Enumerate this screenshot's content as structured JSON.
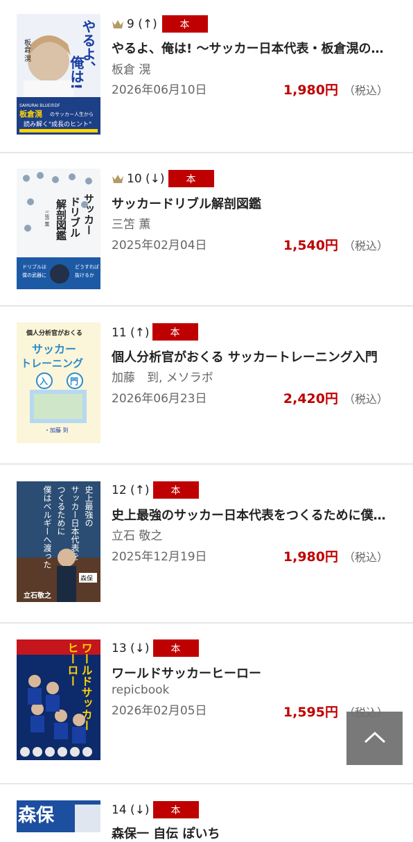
{
  "items": [
    {
      "rank_text": "9 (↑)",
      "crown": true,
      "badge": "本",
      "title": "やるよ、俺は! 〜サッカー日本代表・板倉滉の成長のヒント〜",
      "author": "板倉 滉",
      "date": "2026年06月10日",
      "price": "1,980円",
      "tax": "（税込）",
      "cover": {
        "name": "book-cover-yaruyo",
        "text1": "やるよ、",
        "text2": "俺は!",
        "text3": "板倉滉",
        "accent": "#1a3fa3",
        "bg": "#e9eef7",
        "sub": "のサッカー人生から",
        "sub2": "読み解く\"成長のヒント\"",
        "author": "板倉 滉"
      }
    },
    {
      "rank_text": "10 (↓)",
      "crown": true,
      "badge": "本",
      "title": "サッカードリブル解剖図鑑",
      "author": "三笘 薫",
      "date": "2025年02月04日",
      "price": "1,540円",
      "tax": "（税込）",
      "cover": {
        "name": "book-cover-dribble",
        "text1": "サッカー",
        "text2": "ドリブル",
        "text3": "解剖図鑑",
        "author": "三笘 薫",
        "accent": "#222222",
        "bg": "#f4f6f8"
      }
    },
    {
      "rank_text": "11 (↑)",
      "crown": false,
      "badge": "本",
      "title": "個人分析官がおくる サッカートレーニング入門",
      "author": "加藤　到, メソラボ",
      "date": "2026年06月23日",
      "price": "2,420円",
      "tax": "（税込）",
      "cover": {
        "name": "book-cover-training",
        "text1": "個人分析官がおくる",
        "text2": "サッカー",
        "text3": "トレーニング",
        "text4": "入門",
        "author": "加藤 到",
        "accent": "#2a8bc9",
        "bg": "#fbf5d9"
      }
    },
    {
      "rank_text": "12 (↑)",
      "crown": false,
      "badge": "本",
      "title": "史上最強のサッカー日本代表をつくるために僕はベルギーへ渡った",
      "author": "立石 敬之",
      "date": "2025年12月19日",
      "price": "1,980円",
      "tax": "（税込）",
      "cover": {
        "name": "book-cover-belgium",
        "text1": "史上最強の",
        "text2": "サッカー日本代表を",
        "text3": "つくるために",
        "text4": "僕はベルギーへ渡った",
        "author": "立石敬之",
        "accent": "#1c3a5e",
        "bg": "#2b4d73"
      }
    },
    {
      "rank_text": "13 (↓)",
      "crown": false,
      "badge": "本",
      "title": "ワールドサッカーヒーロー",
      "author": "repicbook",
      "date": "2026年02月05日",
      "price": "1,595円",
      "tax": "（税込）",
      "cover": {
        "name": "book-cover-hero",
        "text1": "ワールドサッカー",
        "text2": "ヒーロー",
        "accent": "#ffd400",
        "bg": "#0d2a6b"
      }
    },
    {
      "rank_text": "14 (↓)",
      "crown": false,
      "badge": "本",
      "title": "森保一 自伝 ぽいち",
      "author": "",
      "date": "",
      "price": "",
      "tax": "",
      "cover": {
        "name": "book-cover-moriyasu",
        "text1": "森保",
        "accent": "#ffffff",
        "bg": "#1d4fa0"
      }
    }
  ],
  "back_to_top": "chevron-up-icon"
}
